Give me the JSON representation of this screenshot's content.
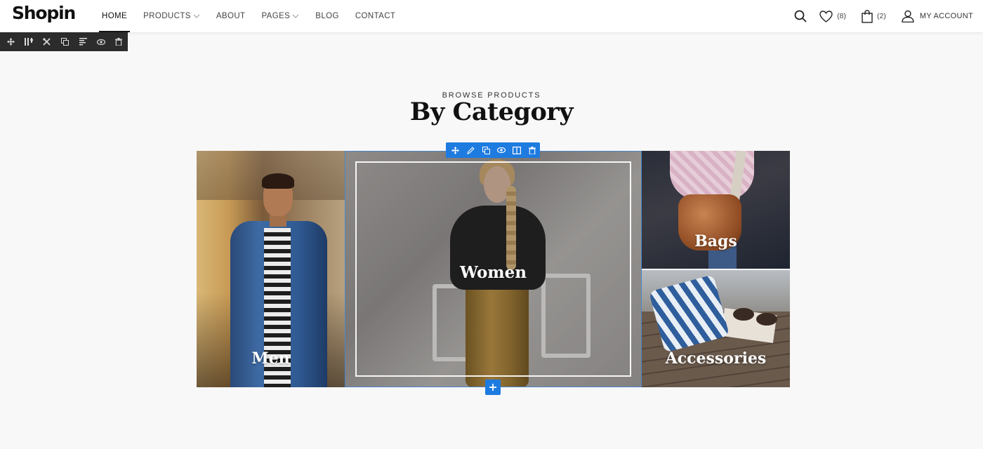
{
  "header": {
    "logo": "Shopin",
    "nav": [
      {
        "label": "HOME",
        "active": true
      },
      {
        "label": "PRODUCTS",
        "dropdown": true
      },
      {
        "label": "ABOUT"
      },
      {
        "label": "PAGES",
        "dropdown": true
      },
      {
        "label": "BLOG"
      },
      {
        "label": "CONTACT"
      }
    ],
    "wishlist_count": "(8)",
    "cart_count": "(2)",
    "account_label": "MY ACCOUNT"
  },
  "row_toolbar": {
    "icons": [
      "move-icon",
      "columns-icon",
      "settings-tools-icon",
      "duplicate-icon",
      "text-align-icon",
      "visibility-icon",
      "trash-icon"
    ]
  },
  "section": {
    "eyebrow": "BROWSE PRODUCTS",
    "title": "By Category"
  },
  "categories": {
    "men": "Men",
    "women": "Women",
    "bags": "Bags",
    "accessories": "Accessories"
  },
  "column_toolbar": {
    "icons": [
      "move-icon",
      "edit-pencil-icon",
      "duplicate-icon",
      "visibility-icon",
      "columns-layout-icon",
      "trash-icon"
    ]
  },
  "add_button": "+",
  "colors": {
    "accent_blue": "#1e7be0",
    "toolbar_dark": "#2c2c2c",
    "background": "#f8f8f8"
  }
}
